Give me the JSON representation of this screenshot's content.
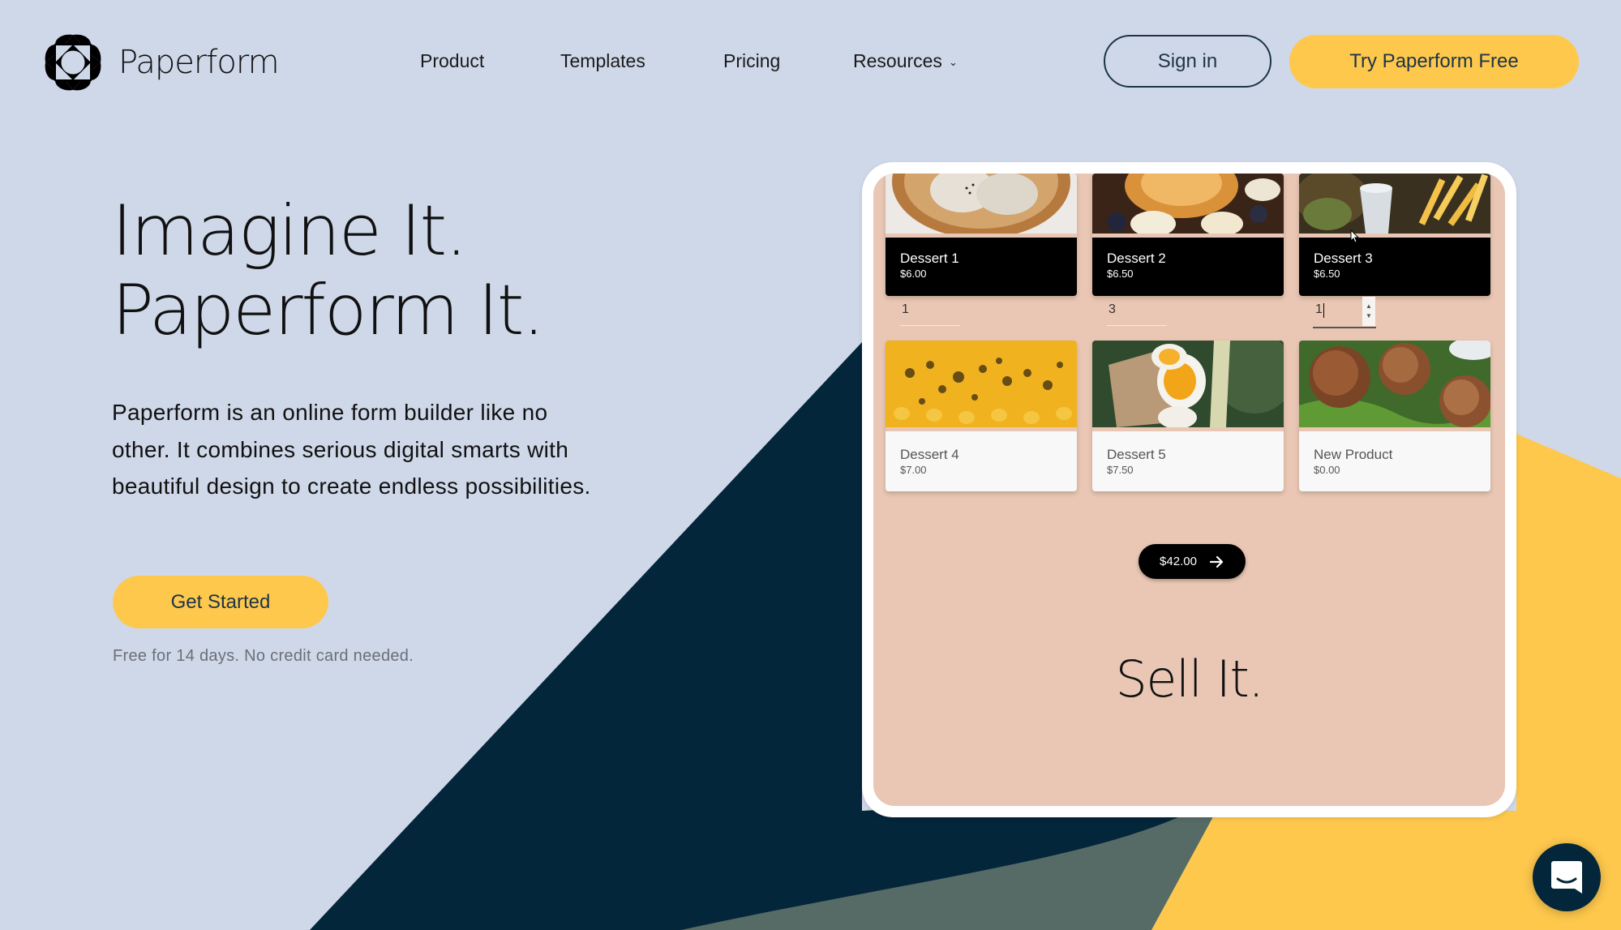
{
  "brand": {
    "name": "Paperform"
  },
  "colors": {
    "background": "#cfd8e9",
    "accent_yellow": "#fec84d",
    "navy": "#04263a",
    "slate": "#566a66",
    "mockup_peach": "#eac7b4",
    "button_text": "#1d3446"
  },
  "nav": {
    "items": [
      {
        "label": "Product"
      },
      {
        "label": "Templates"
      },
      {
        "label": "Pricing"
      },
      {
        "label": "Resources",
        "has_dropdown": true
      }
    ],
    "dropdown_glyph": "⌄",
    "sign_in_label": "Sign in",
    "try_label": "Try Paperform Free"
  },
  "hero": {
    "headline_line1": "Imagine It.",
    "headline_line2": "Paperform It.",
    "description": "Paperform is an online form builder like no other. It combines serious digital smarts with beautiful design to create endless possibilities.",
    "cta_label": "Get Started",
    "note": "Free for 14 days. No credit card needed."
  },
  "mockup": {
    "products_top": [
      {
        "name": "Dessert 1",
        "price": "$6.00",
        "quantity": "1"
      },
      {
        "name": "Dessert 2",
        "price": "$6.50",
        "quantity": "3"
      },
      {
        "name": "Dessert 3",
        "price": "$6.50",
        "quantity": "1"
      }
    ],
    "products_bottom": [
      {
        "name": "Dessert 4",
        "price": "$7.00"
      },
      {
        "name": "Dessert 5",
        "price": "$7.50"
      },
      {
        "name": "New Product",
        "price": "$0.00"
      }
    ],
    "total": "$42.00",
    "total_icon": "arrow-right-icon",
    "tagline": "Sell It."
  },
  "chat": {
    "icon": "chat-icon"
  }
}
